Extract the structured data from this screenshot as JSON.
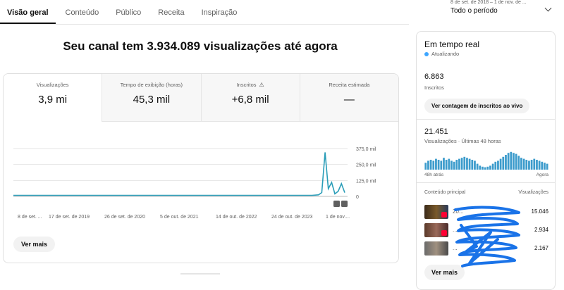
{
  "tabs": [
    {
      "label": "Visão geral",
      "active": true
    },
    {
      "label": "Conteúdo",
      "active": false
    },
    {
      "label": "Público",
      "active": false
    },
    {
      "label": "Receita",
      "active": false
    },
    {
      "label": "Inspiração",
      "active": false
    }
  ],
  "period": {
    "range": "8 de set. de 2018 – 1 de nov. de ...",
    "label": "Todo o período"
  },
  "headline": "Seu canal tem 3.934.089 visualizações até agora",
  "metrics": [
    {
      "label": "Visualizações",
      "value": "3,9 mi"
    },
    {
      "label": "Tempo de exibição (horas)",
      "value": "45,3 mil"
    },
    {
      "label": "Inscritos",
      "value": "+6,8 mil"
    },
    {
      "label": "Receita estimada",
      "value": "—"
    }
  ],
  "more_button": "Ver mais",
  "chart_data": {
    "type": "line",
    "y_ticks": [
      "375,0 mil",
      "250,0 mil",
      "125,0 mil",
      "0"
    ],
    "ylim": [
      0,
      375000
    ],
    "x_tick_labels": [
      "8 de set. ...",
      "17 de set. de 2019",
      "26 de set. de 2020",
      "5 de out. de 2021",
      "14 de out. de 2022",
      "24 de out. de 2023",
      "1 de nov...."
    ],
    "series": [
      {
        "values": [
          8000,
          8000,
          8000,
          8000,
          8000,
          8000,
          8000,
          8000,
          8000,
          8000,
          8000,
          8000,
          8000,
          8000,
          8000,
          8000,
          8000,
          8000,
          8000,
          8000,
          8000,
          8000,
          8000,
          8000,
          8000,
          8000,
          8000,
          8000,
          8000,
          8000,
          8000,
          8000,
          8000,
          8000,
          8000,
          8000,
          8000,
          8000,
          8000,
          8000,
          8000,
          8000,
          8000,
          8000,
          8000,
          8000,
          8000,
          8000,
          8000,
          8000,
          8000,
          8000,
          8000,
          8000,
          8000,
          8000,
          8000,
          8000,
          8000,
          8000,
          8000,
          8000,
          8000,
          8000,
          8000,
          8000,
          8000,
          8000,
          8000,
          8000,
          8000,
          8000,
          8000,
          8000,
          8000,
          8000,
          8000,
          8000,
          8000,
          8000,
          8000,
          8000,
          8000,
          8000,
          8000,
          8000,
          8000,
          8000,
          8000,
          8000,
          8000,
          8000,
          10000,
          12000,
          30000,
          345000,
          60000,
          110000,
          20000,
          40000,
          100000,
          30000
        ]
      }
    ]
  },
  "realtime": {
    "title": "Em tempo real",
    "status": "Atualizando",
    "subscribers": "6.863",
    "subscribers_label": "Inscritos",
    "live_button": "Ver contagem de inscritos ao vivo",
    "views": "21.451",
    "views_label": "Visualizações · Últimas 48 horas",
    "bars_start": "48h atrás",
    "bars_end": "Agora",
    "bar_values": [
      0.35,
      0.45,
      0.5,
      0.45,
      0.55,
      0.5,
      0.45,
      0.6,
      0.5,
      0.55,
      0.45,
      0.4,
      0.5,
      0.55,
      0.6,
      0.65,
      0.6,
      0.55,
      0.5,
      0.45,
      0.3,
      0.2,
      0.15,
      0.12,
      0.15,
      0.2,
      0.3,
      0.4,
      0.45,
      0.55,
      0.65,
      0.75,
      0.85,
      0.9,
      0.85,
      0.8,
      0.7,
      0.6,
      0.55,
      0.5,
      0.45,
      0.5,
      0.55,
      0.5,
      0.45,
      0.4,
      0.35,
      0.3
    ],
    "content_head": "Conteúdo principal",
    "content_head_right": "Visualizações",
    "items": [
      {
        "title": "20...",
        "value": "15.046"
      },
      {
        "title": "...",
        "value": "2.934"
      },
      {
        "title": "...",
        "value": "2.167"
      }
    ],
    "more_button": "Ver mais"
  }
}
